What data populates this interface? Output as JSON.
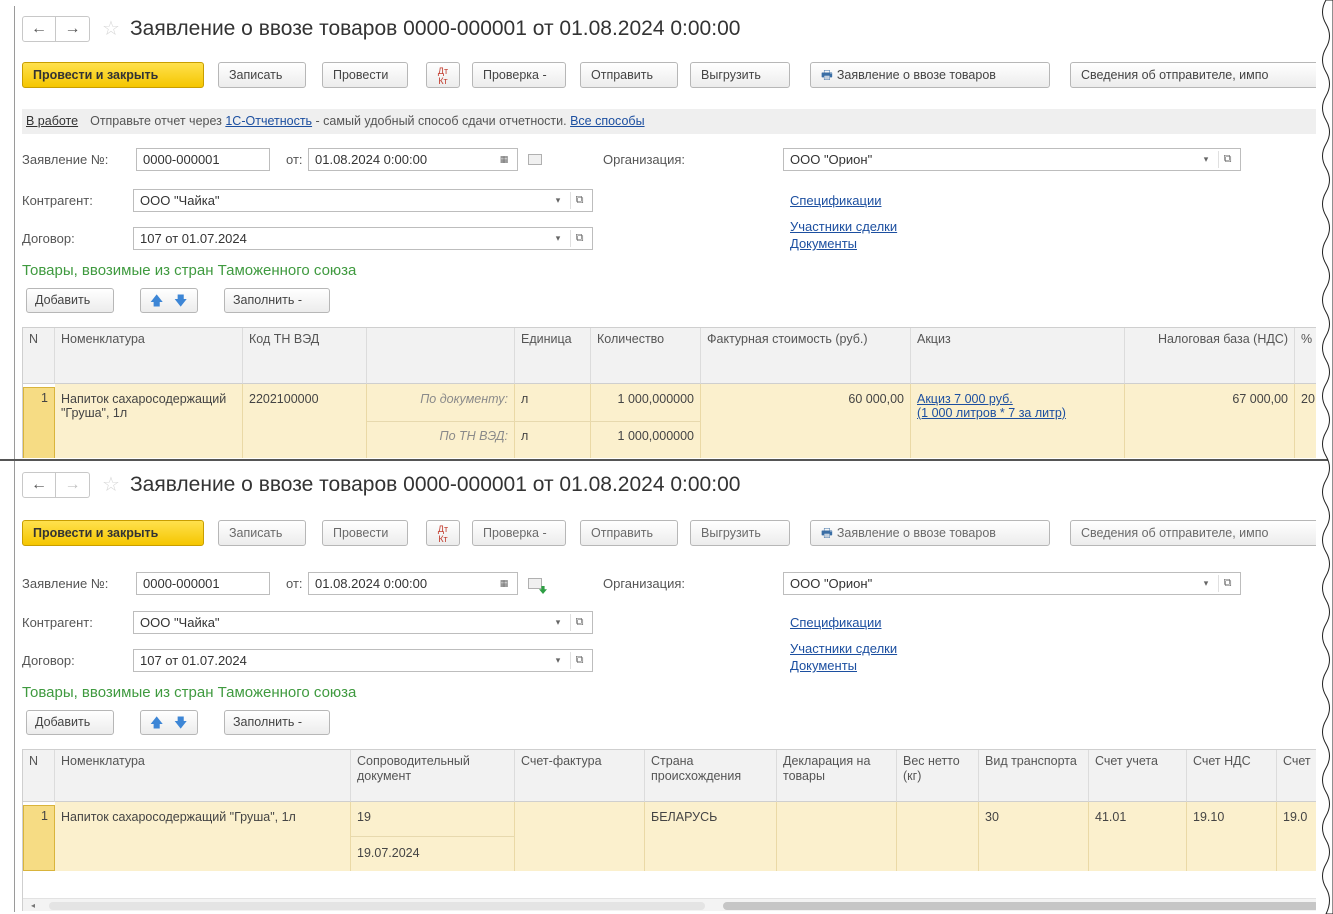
{
  "window": {
    "back_symbol": "←",
    "forward_symbol": "→",
    "star_symbol": "☆",
    "title": "Заявление о ввозе товаров 0000-000001 от 01.08.2024 0:00:00"
  },
  "toolbar": {
    "post_close": "Провести и закрыть",
    "save": "Записать",
    "post": "Провести",
    "dt_kt_top": "Дт",
    "dt_kt_bottom": "Кт",
    "check": "Проверка -",
    "send": "Отправить",
    "upload": "Выгрузить",
    "print_statement": "Заявление о ввозе товаров",
    "sender_info": "Сведения об отправителе, импо"
  },
  "infobar": {
    "status": "В работе",
    "text_before": "Отправьте отчет через ",
    "link_service": "1С-Отчетность",
    "text_after": " - самый удобный способ сдачи отчетности. ",
    "link_all": "Все способы"
  },
  "form": {
    "statement_label": "Заявление №:",
    "statement_value": "0000-000001",
    "from_label": "от:",
    "date_value": "01.08.2024  0:00:00",
    "org_label": "Организация:",
    "org_value": "ООО \"Орион\"",
    "counterparty_label": "Контрагент:",
    "counterparty_value": "ООО \"Чайка\"",
    "contract_label": "Договор:",
    "contract_value": "107 от 01.07.2024",
    "link_specs": "Спецификации",
    "link_participants": "Участники сделки",
    "link_documents": "Документы",
    "dropdown_symbol": "▾",
    "open_symbol": "⧉",
    "calendar_symbol": "▦"
  },
  "goods": {
    "section_title": "Товары, ввозимые из стран Таможенного союза",
    "add": "Добавить",
    "up_symbol": "🡅",
    "down_symbol": "🡇",
    "fill": "Заполнить -"
  },
  "table1": {
    "headers": [
      "N",
      "Номенклатура",
      "Код ТН ВЭД",
      "",
      "Единица",
      "Количество",
      "Фактурная стоимость (руб.)",
      "Акциз",
      "Налоговая база (НДС)",
      "%"
    ],
    "row": {
      "n": "1",
      "nomenclature": "Напиток сахаросодержащий \"Груша\", 1л",
      "code": "2202100000",
      "by_doc_label": "По документу:",
      "by_tnved_label": "По ТН ВЭД:",
      "unit_doc": "л",
      "unit_tnved": "л",
      "qty_doc": "1 000,000000",
      "qty_tnved": "1 000,000000",
      "invoice_cost": "60 000,00",
      "excise_line1": "Акциз 7 000 руб.",
      "excise_line2": "(1 000 литров * 7 за литр)",
      "tax_base": "67 000,00",
      "pct": "20"
    }
  },
  "table2": {
    "headers": [
      "N",
      "Номенклатура",
      "Сопроводительный документ",
      "Счет-фактура",
      "Страна происхождения",
      "Декларация на товары",
      "Вес нетто (кг)",
      "Вид транспорта",
      "Счет учета",
      "Счет НДС",
      "Счет"
    ],
    "row": {
      "n": "1",
      "nomenclature": "Напиток сахаросодержащий \"Груша\", 1л",
      "doc_number": "19",
      "doc_date": "19.07.2024",
      "invoice": "",
      "country": "БЕЛАРУСЬ",
      "declaration": "",
      "weight": "",
      "transport": "30",
      "account": "41.01",
      "vat_account": "19.10",
      "account_more": "19.0"
    },
    "scroll_left_symbol": "◂"
  }
}
